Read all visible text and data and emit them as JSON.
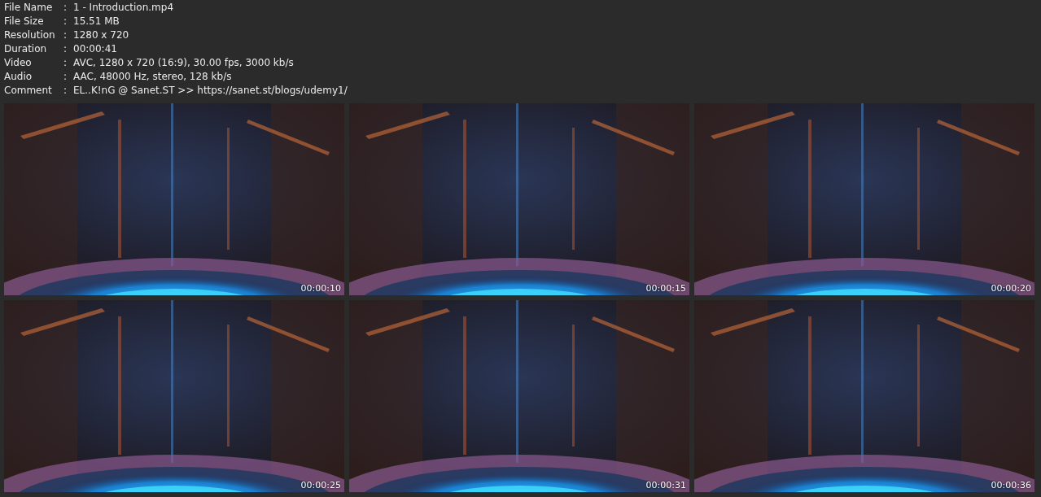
{
  "info": [
    {
      "label": "File Name",
      "separator": ":",
      "value": "1 - Introduction.mp4"
    },
    {
      "label": "File Size",
      "separator": ":",
      "value": "15.51 MB"
    },
    {
      "label": "Resolution",
      "separator": ":",
      "value": "1280 x 720"
    },
    {
      "label": "Duration",
      "separator": ":",
      "value": "00:00:41"
    },
    {
      "label": "Video",
      "separator": ":",
      "value": "AVC, 1280 x 720 (16:9), 30.00 fps, 3000 kb/s"
    },
    {
      "label": "Audio",
      "separator": ":",
      "value": "AAC, 48000 Hz, stereo, 128 kb/s"
    },
    {
      "label": "Comment",
      "separator": ":",
      "value": "EL..K!nG @ Sanet.ST >> https://sanet.st/blogs/udemy1/"
    }
  ],
  "thumbnails": [
    {
      "kind": "picture",
      "timestamp": "00:00:10"
    },
    {
      "kind": "picture",
      "timestamp": "00:00:15"
    },
    {
      "kind": "picture",
      "timestamp": "00:00:20"
    },
    {
      "kind": "picture",
      "timestamp": "00:00:25"
    },
    {
      "kind": "picture",
      "timestamp": "00:00:31"
    },
    {
      "kind": "picture",
      "timestamp": "00:00:36"
    }
  ]
}
